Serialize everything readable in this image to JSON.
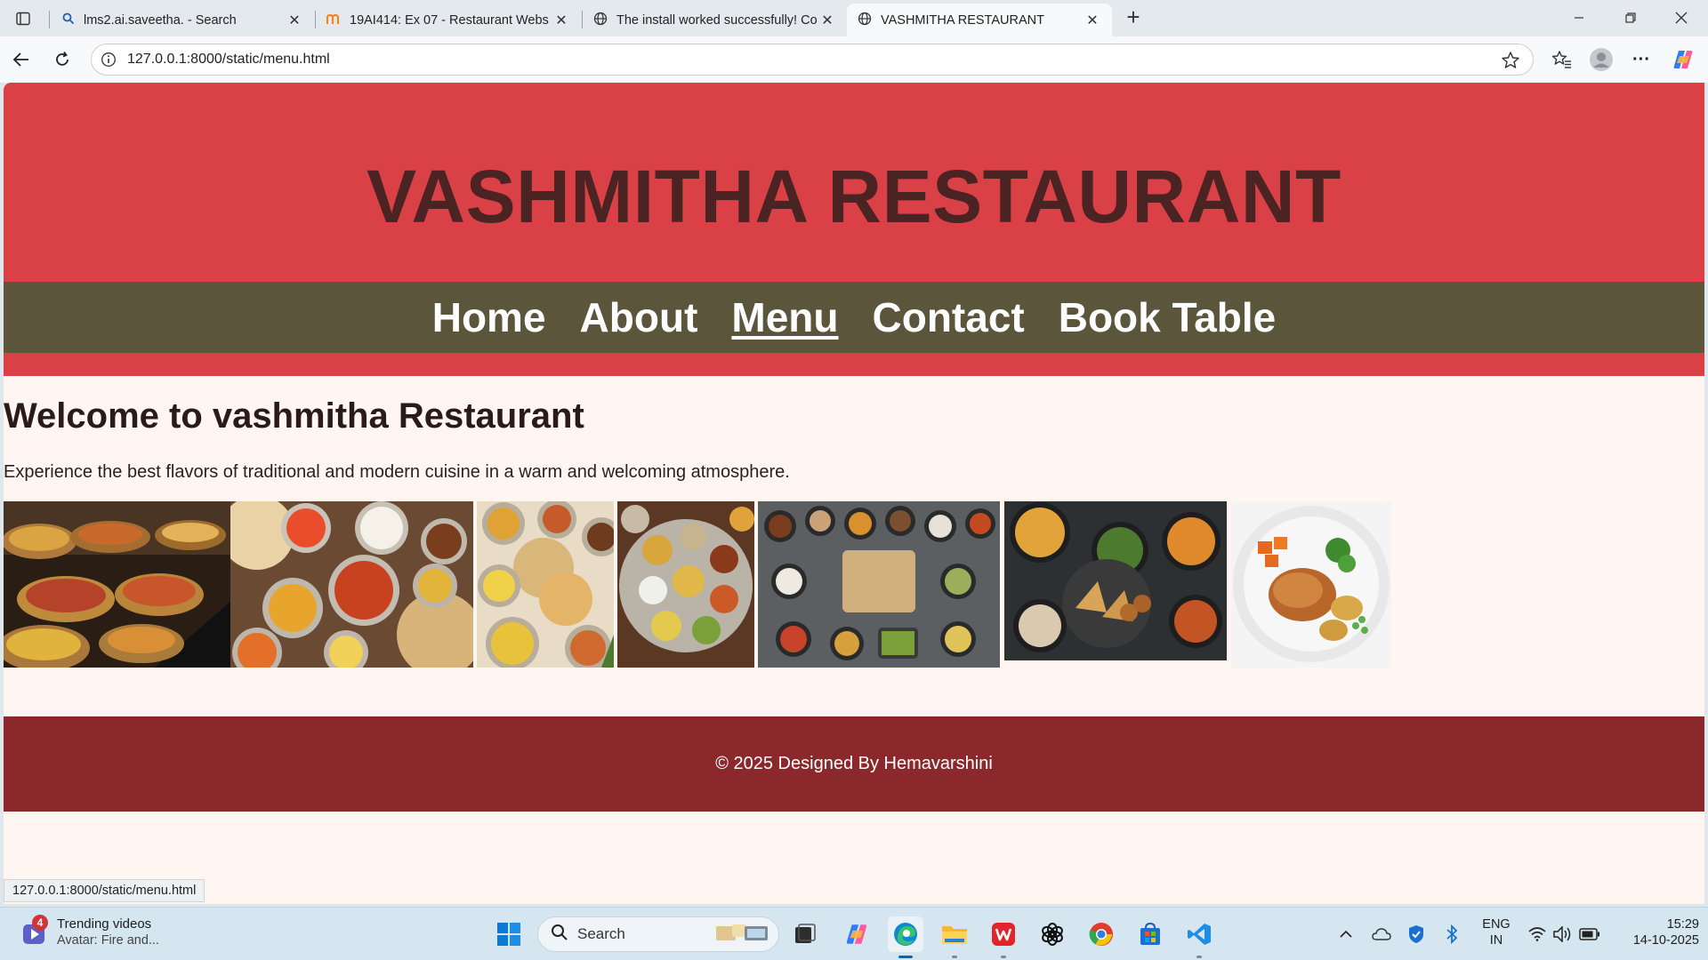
{
  "browser": {
    "tabs": [
      {
        "title": "lms2.ai.saveetha. - Search",
        "icon": "search-icon"
      },
      {
        "title": "19AI414: Ex 07 - Restaurant Webs",
        "icon": "moodle-icon"
      },
      {
        "title": "The install worked successfully! Co",
        "icon": "globe-icon"
      },
      {
        "title": "VASHMITHA RESTAURANT",
        "icon": "globe-icon",
        "active": true
      }
    ],
    "address": "127.0.0.1:8000/static/menu.html",
    "status_url": "127.0.0.1:8000/static/menu.html"
  },
  "site": {
    "title": "VASHMITHA RESTAURANT",
    "nav": [
      {
        "label": "Home"
      },
      {
        "label": "About"
      },
      {
        "label": "Menu",
        "current": true
      },
      {
        "label": "Contact"
      },
      {
        "label": "Book Table"
      }
    ],
    "welcome_heading": "Welcome to vashmitha Restaurant",
    "intro_text": "Experience the best flavors of traditional and modern cuisine in a warm and welcoming atmosphere.",
    "gallery": [
      {
        "subject": "curry-buffet-trays"
      },
      {
        "subject": "broken-image"
      },
      {
        "subject": "indian-spread-with-rotis"
      },
      {
        "subject": "thali-with-puri"
      },
      {
        "subject": "thali-platter"
      },
      {
        "subject": "dishes-on-slate-table"
      },
      {
        "subject": "samosa-and-curries"
      },
      {
        "subject": "roast-chicken-plate"
      }
    ],
    "footer": "© 2025 Designed By Hemavarshini"
  },
  "colors": {
    "header_red": "#d94147",
    "title_brown": "#4b2323",
    "nav_olive": "#5b553b",
    "footer_maroon": "#8b282b",
    "page_bg": "#fff6f1"
  },
  "taskbar": {
    "widget": {
      "title": "Trending videos",
      "subtitle": "Avatar: Fire and...",
      "badge": "4"
    },
    "search_label": "Search",
    "pinned": [
      "windows-start-icon",
      "task-view-icon",
      "copilot-icon",
      "edge-icon",
      "file-explorer-icon",
      "wps-office-icon",
      "chatgpt-icon",
      "chrome-icon",
      "microsoft-store-icon",
      "vscode-icon"
    ],
    "tray": {
      "lang_top": "ENG",
      "lang_bottom": "IN",
      "time": "15:29",
      "date": "14-10-2025"
    }
  }
}
